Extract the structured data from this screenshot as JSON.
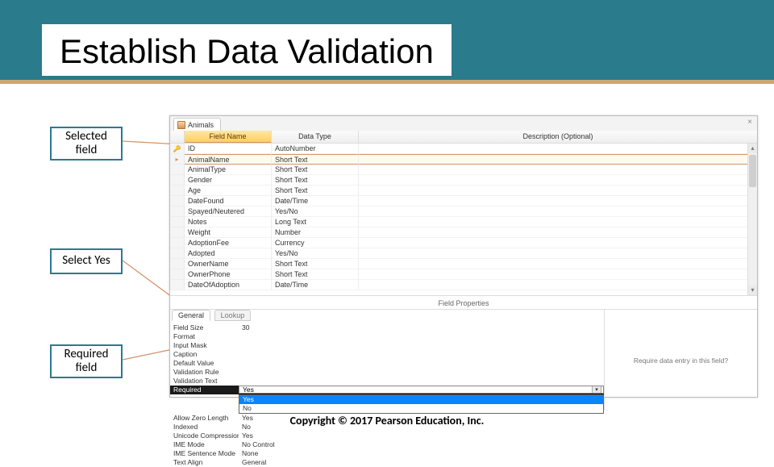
{
  "title": "Establish Data Validation",
  "callouts": {
    "selected_field": "Selected\nfield",
    "select_yes": "Select Yes",
    "required_field": "Required\nfield"
  },
  "tab": {
    "name": "Animals"
  },
  "grid": {
    "headers": {
      "field_name": "Field Name",
      "data_type": "Data Type",
      "description": "Description (Optional)"
    },
    "rows": [
      {
        "name": "ID",
        "type": "AutoNumber",
        "key": true
      },
      {
        "name": "AnimalName",
        "type": "Short Text",
        "selected": true
      },
      {
        "name": "AnimalType",
        "type": "Short Text"
      },
      {
        "name": "Gender",
        "type": "Short Text"
      },
      {
        "name": "Age",
        "type": "Short Text"
      },
      {
        "name": "DateFound",
        "type": "Date/Time"
      },
      {
        "name": "Spayed/Neutered",
        "type": "Yes/No"
      },
      {
        "name": "Notes",
        "type": "Long Text"
      },
      {
        "name": "Weight",
        "type": "Number"
      },
      {
        "name": "AdoptionFee",
        "type": "Currency"
      },
      {
        "name": "Adopted",
        "type": "Yes/No"
      },
      {
        "name": "OwnerName",
        "type": "Short Text"
      },
      {
        "name": "OwnerPhone",
        "type": "Short Text"
      },
      {
        "name": "DateOfAdoption",
        "type": "Date/Time"
      }
    ]
  },
  "field_props_label": "Field Properties",
  "props_tabs": {
    "general": "General",
    "lookup": "Lookup"
  },
  "properties": [
    {
      "label": "Field Size",
      "value": "30"
    },
    {
      "label": "Format",
      "value": ""
    },
    {
      "label": "Input Mask",
      "value": ""
    },
    {
      "label": "Caption",
      "value": ""
    },
    {
      "label": "Default Value",
      "value": ""
    },
    {
      "label": "Validation Rule",
      "value": ""
    },
    {
      "label": "Validation Text",
      "value": ""
    },
    {
      "label": "Required",
      "value": "Yes",
      "highlight": true,
      "dropdown": [
        "Yes",
        "No"
      ]
    },
    {
      "label": "Allow Zero Length",
      "value": "Yes"
    },
    {
      "label": "Indexed",
      "value": "No"
    },
    {
      "label": "Unicode Compression",
      "value": "Yes"
    },
    {
      "label": "IME Mode",
      "value": "No Control"
    },
    {
      "label": "IME Sentence Mode",
      "value": "None"
    },
    {
      "label": "Text Align",
      "value": "General"
    }
  ],
  "help_text": "Require data entry in this field?",
  "copyright": "Copyright © 2017 Pearson Education, Inc."
}
